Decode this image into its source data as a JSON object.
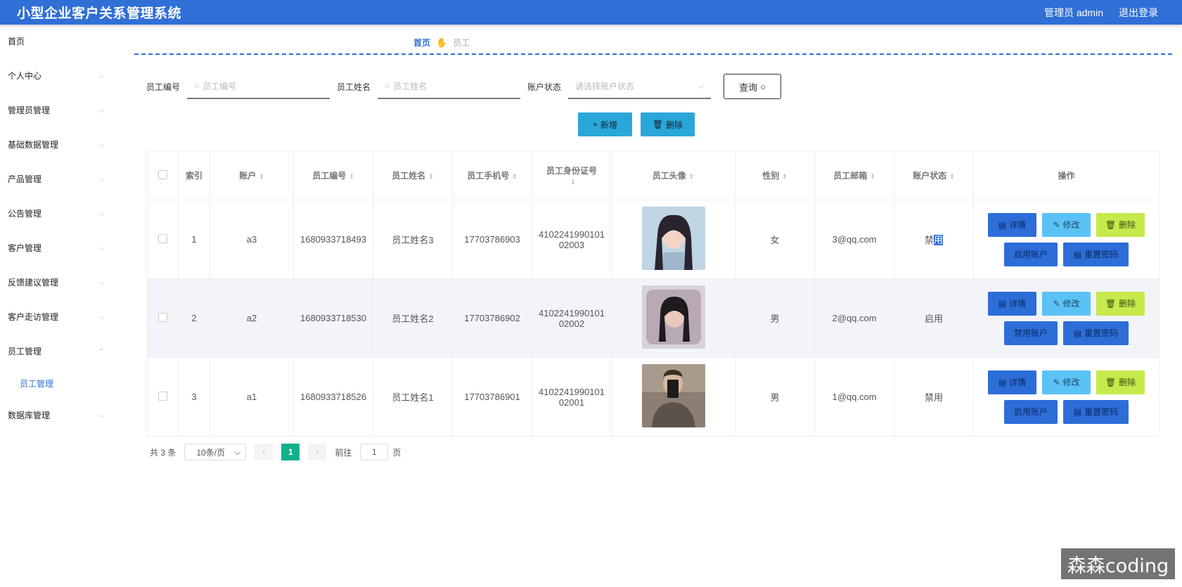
{
  "header": {
    "title": "小型企业客户关系管理系统",
    "user": "管理员 admin",
    "logout": "退出登录",
    "bg_color": "#2f6fd6"
  },
  "sidebar": {
    "items": [
      {
        "label": "首页",
        "chevron": false
      },
      {
        "label": "个人中心",
        "chevron": true
      },
      {
        "label": "管理员管理",
        "chevron": true
      },
      {
        "label": "基础数据管理",
        "chevron": true
      },
      {
        "label": "产品管理",
        "chevron": true
      },
      {
        "label": "公告管理",
        "chevron": true
      },
      {
        "label": "客户管理",
        "chevron": true
      },
      {
        "label": "反馈建议管理",
        "chevron": true
      },
      {
        "label": "客户走访管理",
        "chevron": true
      },
      {
        "label": "员工管理",
        "chevron": true,
        "expanded": true
      }
    ],
    "sub_item": "员工管理",
    "last_item": "数据库管理"
  },
  "breadcrumb": {
    "home": "首页",
    "current": "员工"
  },
  "search": {
    "emp_no_label": "员工编号",
    "emp_no_placeholder": "员工编号",
    "emp_name_label": "员工姓名",
    "emp_name_placeholder": "员工姓名",
    "status_label": "账户状态",
    "status_placeholder": "请选择账户状态",
    "query_btn": "查询"
  },
  "toolbar": {
    "add": "新增",
    "delete": "删除"
  },
  "table": {
    "headers": [
      "索引",
      "账户",
      "员工编号",
      "员工姓名",
      "员工手机号",
      "员工身份证号",
      "员工头像",
      "性别",
      "员工邮箱",
      "账户状态",
      "操作"
    ],
    "rows": [
      {
        "index": "1",
        "account": "a3",
        "emp_no": "1680933718493",
        "name": "员工姓名3",
        "phone": "17703786903",
        "id_line1": "4102241990101",
        "id_line2": "02003",
        "gender": "女",
        "email": "3@qq.com",
        "status_a": "禁",
        "status_b": "用",
        "toggle": "启用账户"
      },
      {
        "index": "2",
        "account": "a2",
        "emp_no": "1680933718530",
        "name": "员工姓名2",
        "phone": "17703786902",
        "id_line1": "4102241990101",
        "id_line2": "02002",
        "gender": "男",
        "email": "2@qq.com",
        "status_a": "启用",
        "status_b": "",
        "toggle": "禁用账户"
      },
      {
        "index": "3",
        "account": "a1",
        "emp_no": "1680933718526",
        "name": "员工姓名1",
        "phone": "17703786901",
        "id_line1": "4102241990101",
        "id_line2": "02001",
        "gender": "男",
        "email": "1@qq.com",
        "status_a": "禁用",
        "status_b": "",
        "toggle": "启用账户"
      }
    ],
    "op_labels": {
      "detail": "详情",
      "edit": "修改",
      "delete": "删除",
      "reset": "重置密码"
    }
  },
  "pager": {
    "total": "共 3 条",
    "page_size": "10条/页",
    "current": "1",
    "goto_prefix": "前往",
    "goto_value": "1",
    "goto_suffix": "页"
  },
  "watermark": "森森coding"
}
